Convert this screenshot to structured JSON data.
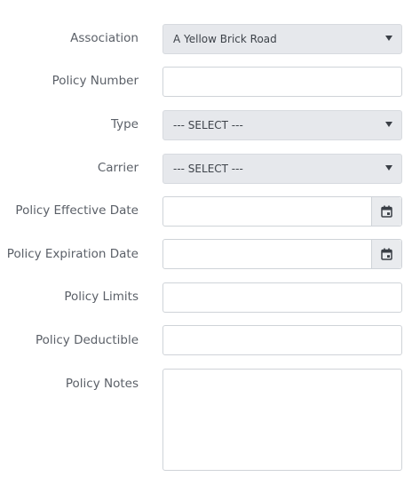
{
  "form": {
    "association": {
      "label": "Association",
      "value": "A Yellow Brick Road",
      "icon": "chevron-down-icon"
    },
    "policy_number": {
      "label": "Policy Number",
      "value": ""
    },
    "type": {
      "label": "Type",
      "value": "--- SELECT ---",
      "icon": "chevron-down-icon"
    },
    "carrier": {
      "label": "Carrier",
      "value": "--- SELECT ---",
      "icon": "chevron-down-icon"
    },
    "effective_date": {
      "label": "Policy Effective Date",
      "value": "",
      "icon": "calendar-icon"
    },
    "expiration_date": {
      "label": "Policy Expiration Date",
      "value": "",
      "icon": "calendar-icon"
    },
    "limits": {
      "label": "Policy Limits",
      "value": ""
    },
    "deductible": {
      "label": "Policy Deductible",
      "value": ""
    },
    "notes": {
      "label": "Policy Notes",
      "value": ""
    }
  }
}
